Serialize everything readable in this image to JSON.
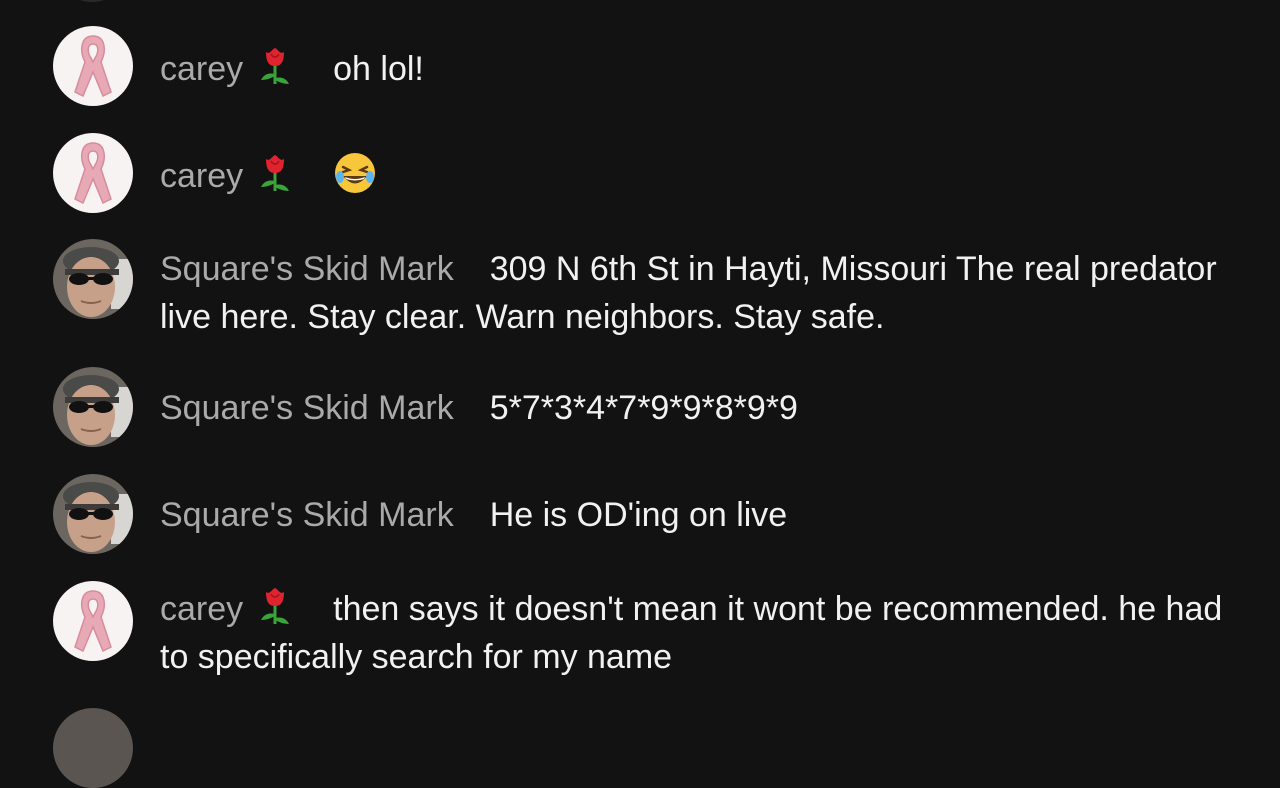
{
  "messages": [
    {
      "author": "carey",
      "text": "oh lol!",
      "avatar": "pink-ribbon-icon",
      "badge": "rose-icon"
    },
    {
      "author": "carey",
      "text": "",
      "emoji": "tears-of-joy-icon",
      "avatar": "pink-ribbon-icon",
      "badge": "rose-icon"
    },
    {
      "author": "Square's Skid Mark",
      "text": "309 N 6th St in Hayti, Missouri The real predator live here. Stay clear. Warn neighbors. Stay safe.",
      "avatar": "person-with-sunglasses-photo"
    },
    {
      "author": "Square's Skid Mark",
      "text": "5*7*3*4*7*9*9*8*9*9",
      "avatar": "person-with-sunglasses-photo"
    },
    {
      "author": "Square's Skid Mark",
      "text": "He is OD'ing on live",
      "avatar": "person-with-sunglasses-photo"
    },
    {
      "author": "carey",
      "text": "then says it doesn't mean it wont be recommended. he had to specifically search for my name",
      "avatar": "pink-ribbon-icon",
      "badge": "rose-icon"
    }
  ],
  "colors": {
    "background": "#121212",
    "author": "#aaaaaa",
    "message": "#f1f1f1"
  }
}
